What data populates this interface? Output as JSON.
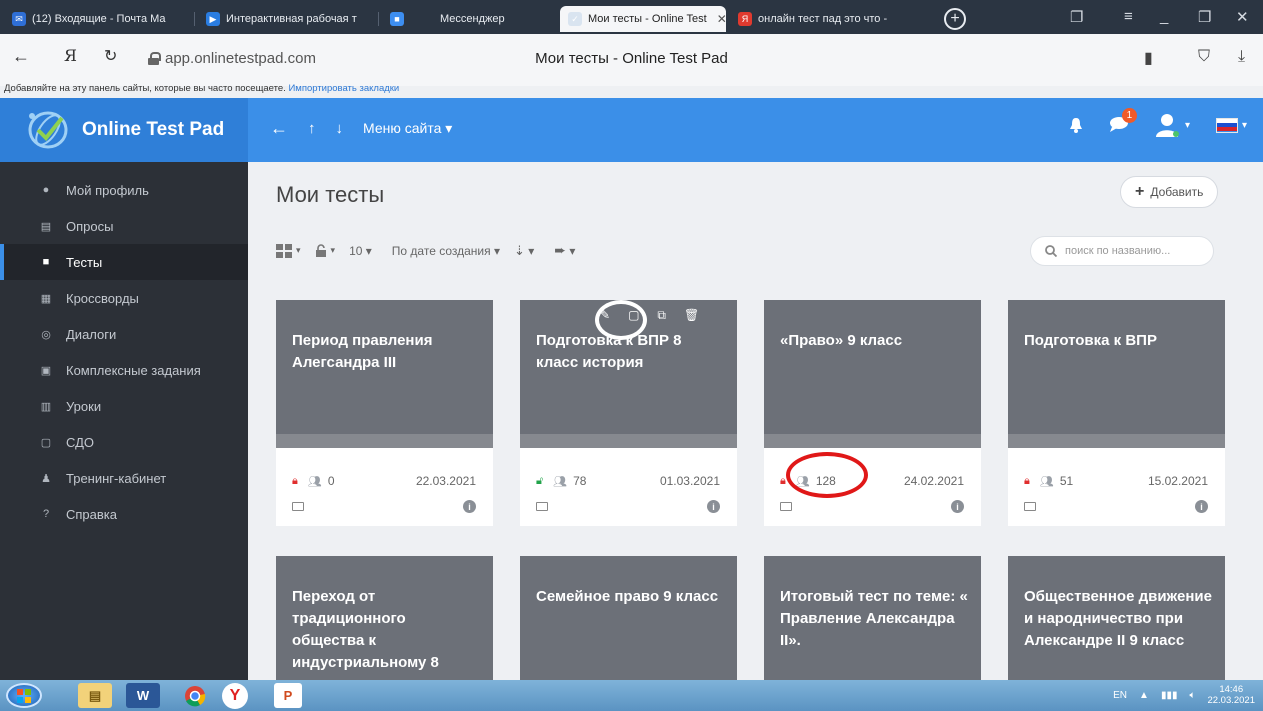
{
  "browser": {
    "tabs": [
      {
        "label": "(12) Входящие - Почта Ма",
        "fav_color": "#2f6fd6",
        "fav_glyph": "✉"
      },
      {
        "label": "Интерактивная рабочая т",
        "fav_color": "#2a7de1",
        "fav_glyph": "▶"
      },
      {
        "label": "Мессенджер",
        "fav_color": "#3d8ef0",
        "fav_glyph": "■"
      },
      {
        "label": "Мои тесты - Online Test",
        "fav_color": "#d9e4f0",
        "fav_glyph": "✓"
      },
      {
        "label": "онлайн тест пад это что -",
        "fav_color": "#e03a2f",
        "fav_glyph": "Я"
      }
    ],
    "close_glyph": "✕",
    "url": "app.onlinetestpad.com",
    "page_title": "Мои тесты - Online Test Pad",
    "bookmarks_text": "Добавляйте на эту панель сайты, которые вы часто посещаете.",
    "bookmarks_link": "Импортировать закладки"
  },
  "header": {
    "logo_text": "Online Test Pad",
    "menu_label": "Меню сайта",
    "notification_count": "1"
  },
  "sidebar": {
    "items": [
      {
        "label": "Мой профиль",
        "icon": "user-icon",
        "glyph": "●"
      },
      {
        "label": "Опросы",
        "icon": "poll-icon",
        "glyph": "▤"
      },
      {
        "label": "Тесты",
        "icon": "test-icon",
        "glyph": "■"
      },
      {
        "label": "Кроссворды",
        "icon": "crossword-icon",
        "glyph": "▦"
      },
      {
        "label": "Диалоги",
        "icon": "dialog-icon",
        "glyph": "◎"
      },
      {
        "label": "Комплексные задания",
        "icon": "tasks-icon",
        "glyph": "▣"
      },
      {
        "label": "Уроки",
        "icon": "lessons-icon",
        "glyph": "▥"
      },
      {
        "label": "СДО",
        "icon": "lms-icon",
        "glyph": "▢"
      },
      {
        "label": "Тренинг-кабинет",
        "icon": "training-icon",
        "glyph": "♟"
      },
      {
        "label": "Справка",
        "icon": "help-icon",
        "glyph": "?"
      }
    ],
    "active_index": 2
  },
  "main": {
    "title": "Мои тесты",
    "add_label": "Добавить",
    "page_size": "10",
    "sort_label": "По дате создания",
    "search_placeholder": "поиск по названию..."
  },
  "cards": [
    {
      "title": "Период правления Алегсандра III",
      "locked": true,
      "count": "0",
      "date": "22.03.2021"
    },
    {
      "title": "Подготовка к ВПР 8 класс история",
      "locked": false,
      "count": "78",
      "date": "01.03.2021"
    },
    {
      "title": "«Право» 9 класс",
      "locked": true,
      "count": "128",
      "date": "24.02.2021"
    },
    {
      "title": "Подготовка к ВПР",
      "locked": true,
      "count": "51",
      "date": "15.02.2021"
    },
    {
      "title": "Переход от традиционного общества к индустриальному 8",
      "locked": null,
      "count": "",
      "date": ""
    },
    {
      "title": "Семейное право 9 класс",
      "locked": null,
      "count": "",
      "date": ""
    },
    {
      "title": "Итоговый тест по теме: « Правление Александра II».",
      "locked": null,
      "count": "",
      "date": ""
    },
    {
      "title": "Общественное движение и народничество при Александре II 9 класс",
      "locked": null,
      "count": "",
      "date": ""
    }
  ],
  "taskbar": {
    "lang": "EN",
    "time": "14:46",
    "date": "22.03.2021"
  },
  "colors": {
    "accent": "#3b8fe8",
    "sidebar_bg": "#2c3037",
    "card_bg": "#6c7078",
    "lock_red": "#e02e2e",
    "lock_green": "#22a34a",
    "annotation_red": "#e01818"
  }
}
